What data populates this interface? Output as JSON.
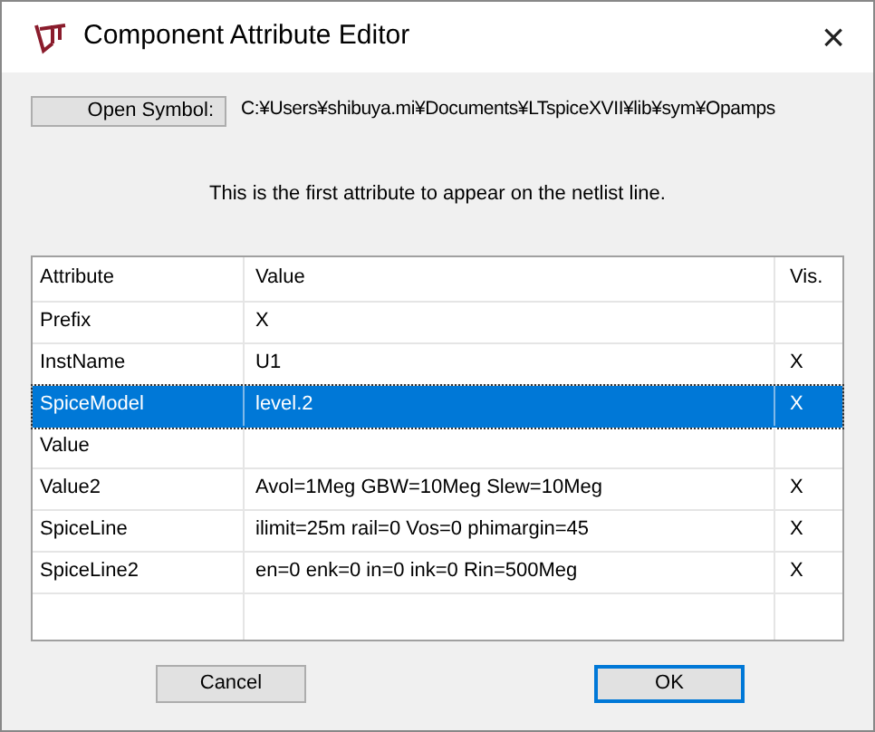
{
  "window": {
    "title": "Component Attribute Editor",
    "close": "×"
  },
  "open_symbol": {
    "label": "Open Symbol:",
    "path": "C:¥Users¥shibuya.mi¥Documents¥LTspiceXVII¥lib¥sym¥Opamps"
  },
  "notice": "This is the first attribute to appear on the netlist line.",
  "table": {
    "columns": [
      "Attribute",
      "Value",
      "Vis."
    ],
    "rows": [
      {
        "attribute": "Prefix",
        "value": "X",
        "vis": "",
        "selected": false
      },
      {
        "attribute": "InstName",
        "value": "U1",
        "vis": "X",
        "selected": false
      },
      {
        "attribute": "SpiceModel",
        "value": "level.2",
        "vis": "X",
        "selected": true
      },
      {
        "attribute": "Value",
        "value": "",
        "vis": "",
        "selected": false
      },
      {
        "attribute": "Value2",
        "value": "Avol=1Meg GBW=10Meg Slew=10Meg",
        "vis": "X",
        "selected": false
      },
      {
        "attribute": "SpiceLine",
        "value": "ilimit=25m rail=0 Vos=0 phimargin=45",
        "vis": "X",
        "selected": false
      },
      {
        "attribute": "SpiceLine2",
        "value": "en=0 enk=0 in=0 ink=0 Rin=500Meg",
        "vis": "X",
        "selected": false
      }
    ]
  },
  "buttons": [
    {
      "label": "Cancel",
      "default": false
    },
    {
      "label": "OK",
      "default": true
    }
  ]
}
